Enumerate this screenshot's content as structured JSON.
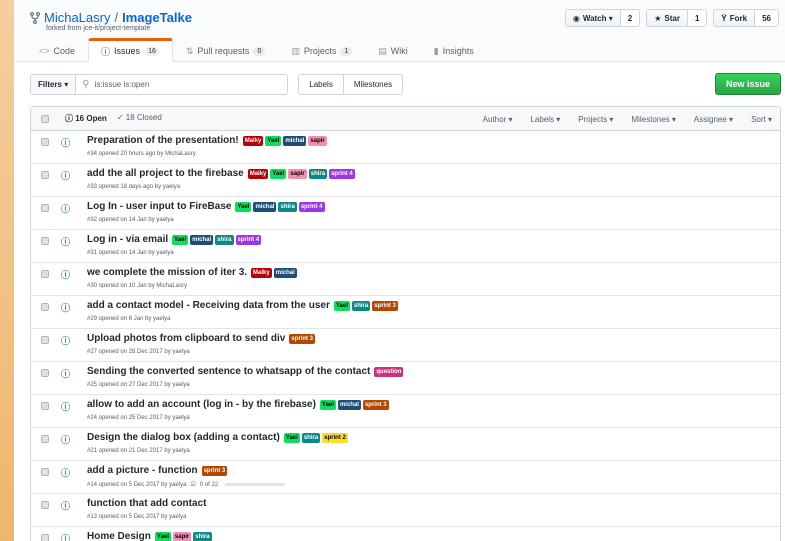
{
  "repo": {
    "owner": "MichaLasry",
    "separator": "/",
    "name": "ImageTalke",
    "forked_from": "forked from jce-it/project-template"
  },
  "actions": {
    "watch_label": "Watch ▾",
    "watch_count": "2",
    "star_label": "Star",
    "star_count": "1",
    "fork_label": "Fork",
    "fork_count": "56"
  },
  "tabs": [
    {
      "label": "Code",
      "icon": "code-icon"
    },
    {
      "label": "Issues",
      "count": "16",
      "icon": "issue-icon"
    },
    {
      "label": "Pull requests",
      "count": "0",
      "icon": "pull-request-icon"
    },
    {
      "label": "Projects",
      "count": "1",
      "icon": "project-icon"
    },
    {
      "label": "Wiki",
      "icon": "book-icon"
    },
    {
      "label": "Insights",
      "icon": "graph-icon"
    }
  ],
  "subnav": {
    "filters_label": "Filters ▾",
    "search_value": "is:issue is:open",
    "labels_label": "Labels",
    "milestones_label": "Milestones",
    "new_issue_label": "New issue"
  },
  "header": {
    "open_label": "16 Open",
    "closed_label": "18 Closed",
    "menus": [
      "Author ▾",
      "Labels ▾",
      "Projects ▾",
      "Milestones ▾",
      "Assignee ▾",
      "Sort ▾"
    ]
  },
  "label_colors": {
    "Malky": {
      "bg": "#b60205",
      "fg": "#ffffff"
    },
    "Yael": {
      "bg": "#0bdf5d",
      "fg": "#000000"
    },
    "michal": {
      "bg": "#1d4f76",
      "fg": "#ffffff"
    },
    "sapir": {
      "bg": "#f28fb2",
      "fg": "#000000"
    },
    "shira": {
      "bg": "#0e8a84",
      "fg": "#ffffff"
    },
    "sprint 4": {
      "bg": "#9b37e6",
      "fg": "#ffffff"
    },
    "sprint 3": {
      "bg": "#b34700",
      "fg": "#ffffff"
    },
    "sprint 2": {
      "bg": "#f7e02b",
      "fg": "#000000"
    },
    "question": {
      "bg": "#cc317c",
      "fg": "#ffffff"
    }
  },
  "issues": [
    {
      "title": "Preparation of the presentation!",
      "labels": [
        "Malky",
        "Yael",
        "michal",
        "sapir"
      ],
      "meta": "#34 opened 20 hours ago by MichaLasry"
    },
    {
      "title": "add the all project to the firebase",
      "labels": [
        "Malky",
        "Yael",
        "sapir",
        "shira",
        "sprint 4"
      ],
      "meta": "#33 opened 18 days ago by yaelya"
    },
    {
      "title": "Log In - user input to FireBase",
      "labels": [
        "Yael",
        "michal",
        "shira",
        "sprint 4"
      ],
      "meta": "#32 opened on 14 Jan by yaelya"
    },
    {
      "title": "Log in - via email",
      "labels": [
        "Yael",
        "michal",
        "shira",
        "sprint 4"
      ],
      "meta": "#31 opened on 14 Jan by yaelya"
    },
    {
      "title": "we complete the mission of iter 3.",
      "labels": [
        "Malky",
        "michal"
      ],
      "meta": "#30 opened on 10 Jan by MichaLasry"
    },
    {
      "title": "add a contact model - Receiving data from the user",
      "labels": [
        "Yael",
        "shira",
        "sprint 3"
      ],
      "meta": "#29 opened on 6 Jan by yaelya"
    },
    {
      "title": "Upload photos from clipboard to send div",
      "labels": [
        "sprint 3"
      ],
      "meta": "#27 opened on 28 Dec 2017 by yaelya"
    },
    {
      "title": "Sending the converted sentence to whatsapp of the contact",
      "labels": [
        "question"
      ],
      "meta": "#25 opened on 27 Dec 2017 by yaelya"
    },
    {
      "title": "allow to add an account (log in - by the firebase)",
      "labels": [
        "Yael",
        "michal",
        "sprint 3"
      ],
      "meta": "#24 opened on 25 Dec 2017 by yaelya"
    },
    {
      "title": "Design the dialog box (adding a contact)",
      "labels": [
        "Yael",
        "shira",
        "sprint 2"
      ],
      "meta": "#21 opened on 21 Dec 2017 by yaelya"
    },
    {
      "title": "add a picture - function",
      "labels": [
        "sprint 3"
      ],
      "meta": "#14 opened on 5 Dec 2017 by yaelya",
      "tasks": "0 of 22"
    },
    {
      "title": "function that add contact",
      "labels": [],
      "meta": "#13 opened on 5 Dec 2017 by yaelya"
    },
    {
      "title": "Home Design",
      "labels": [
        "Yael",
        "sapir",
        "shira"
      ],
      "meta": ""
    }
  ]
}
